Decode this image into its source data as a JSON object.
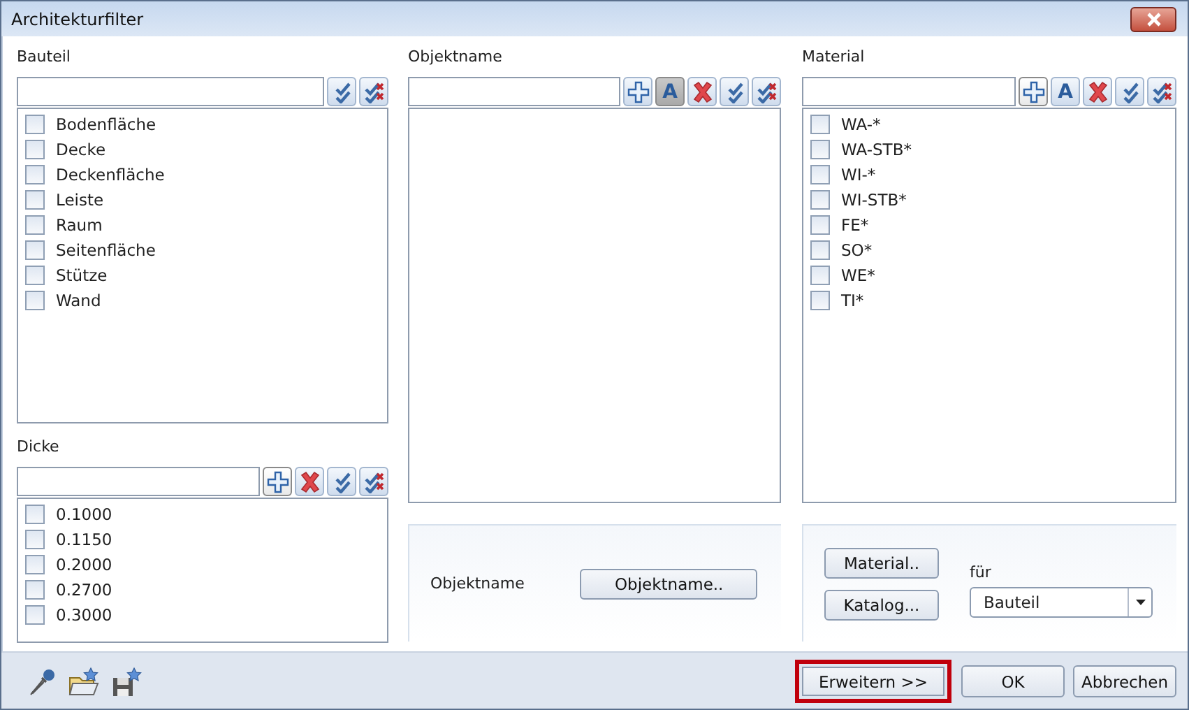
{
  "window": {
    "title": "Architekturfilter"
  },
  "panels": [
    {
      "label": "Bauteil",
      "tools": [
        {
          "kind": "check-all",
          "pressed": false
        },
        {
          "kind": "uncheck-all",
          "pressed": false
        }
      ],
      "items": [
        {
          "label": "Bodenfläche",
          "checked": false
        },
        {
          "label": "Decke",
          "checked": false
        },
        {
          "label": "Deckenfläche",
          "checked": false
        },
        {
          "label": "Leiste",
          "checked": false
        },
        {
          "label": "Raum",
          "checked": false
        },
        {
          "label": "Seitenfläche",
          "checked": false
        },
        {
          "label": "Stütze",
          "checked": false
        },
        {
          "label": "Wand",
          "checked": false
        }
      ]
    },
    {
      "label": "Dicke",
      "tools": [
        {
          "kind": "add",
          "pressed": true
        },
        {
          "kind": "delete",
          "pressed": false
        },
        {
          "kind": "check-all",
          "pressed": false
        },
        {
          "kind": "uncheck-all",
          "pressed": false
        }
      ],
      "items": [
        {
          "label": "0.1000",
          "checked": false
        },
        {
          "label": "0.1150",
          "checked": false
        },
        {
          "label": "0.2000",
          "checked": false
        },
        {
          "label": "0.2700",
          "checked": false
        },
        {
          "label": "0.3000",
          "checked": false
        }
      ]
    },
    {
      "label": "Objektname",
      "tools": [
        {
          "kind": "add",
          "pressed": false
        },
        {
          "kind": "text",
          "text": "A",
          "pressed": true
        },
        {
          "kind": "delete",
          "pressed": false
        },
        {
          "kind": "check-all",
          "pressed": false
        },
        {
          "kind": "uncheck-all",
          "pressed": false
        }
      ]
    },
    {
      "label": "Material",
      "tools": [
        {
          "kind": "add",
          "pressed": true
        },
        {
          "kind": "text",
          "text": "A",
          "pressed": false
        },
        {
          "kind": "delete",
          "pressed": false
        },
        {
          "kind": "check-all",
          "pressed": false
        },
        {
          "kind": "uncheck-all",
          "pressed": false
        }
      ],
      "items": [
        {
          "label": "WA-*",
          "checked": false
        },
        {
          "label": "WA-STB*",
          "checked": false
        },
        {
          "label": "WI-*",
          "checked": false
        },
        {
          "label": "WI-STB*",
          "checked": false
        },
        {
          "label": "FE*",
          "checked": false
        },
        {
          "label": "SO*",
          "checked": false
        },
        {
          "label": "WE*",
          "checked": false
        },
        {
          "label": "TI*",
          "checked": false
        }
      ]
    }
  ],
  "objektname_box": {
    "label": "Objektname",
    "button": "Objektname.."
  },
  "material_box": {
    "buttons": [
      "Material..",
      "Katalog..."
    ],
    "for_label": "für",
    "dropdown": {
      "value": "Bauteil"
    }
  },
  "footer_buttons": [
    {
      "label": "Erweitern >>",
      "highlighted": true
    },
    {
      "label": "OK",
      "highlighted": false
    },
    {
      "label": "Abbrechen",
      "highlighted": false
    }
  ]
}
